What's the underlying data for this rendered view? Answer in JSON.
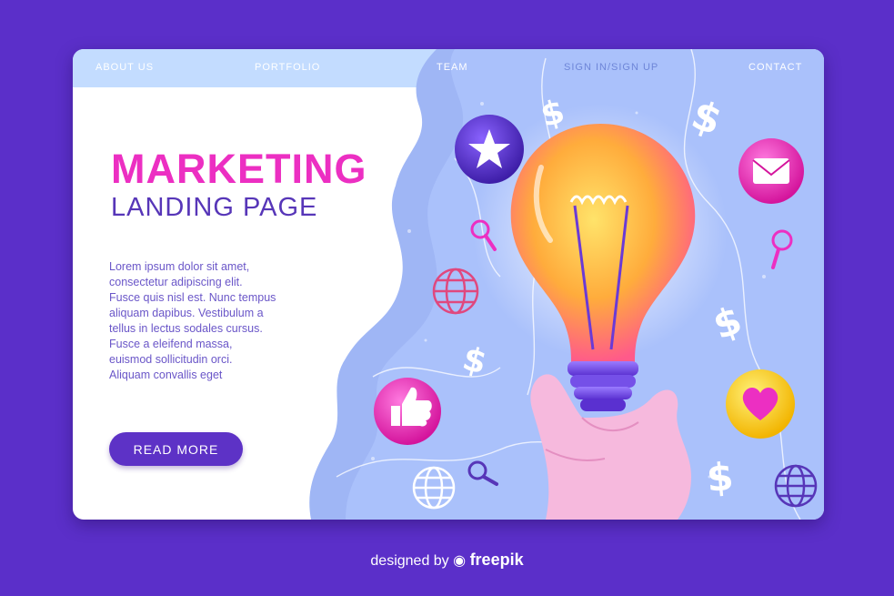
{
  "nav": {
    "items": [
      "ABOUT US",
      "PORTFOLIO",
      "TEAM",
      "SIGN IN/SIGN UP",
      "CONTACT"
    ]
  },
  "hero": {
    "title": "MARKETING",
    "subtitle": "LANDING PAGE",
    "body_lines": [
      "Lorem ipsum dolor sit amet,",
      "consectetur adipiscing elit.",
      "Fusce quis nisl est. Nunc tempus",
      "aliquam dapibus. Vestibulum a",
      "tellus in lectus sodales cursus.",
      "Fusce a eleifend massa,",
      "euismod sollicitudin orci.",
      "Aliquam convallis eget"
    ],
    "button_label": "READ MORE"
  },
  "footer": {
    "prefix": "designed by",
    "brand": "freepik"
  },
  "icons": [
    "lightbulb-icon",
    "hand-icon",
    "star-icon",
    "email-icon",
    "like-icon",
    "heart-icon",
    "globe-icon",
    "dollar-icon",
    "search-icon"
  ],
  "colors": {
    "background": "#5b2fc9",
    "accent_pink": "#ec2fc2",
    "accent_purple": "#5736b8",
    "panel_blue": "#9fb6f5"
  }
}
